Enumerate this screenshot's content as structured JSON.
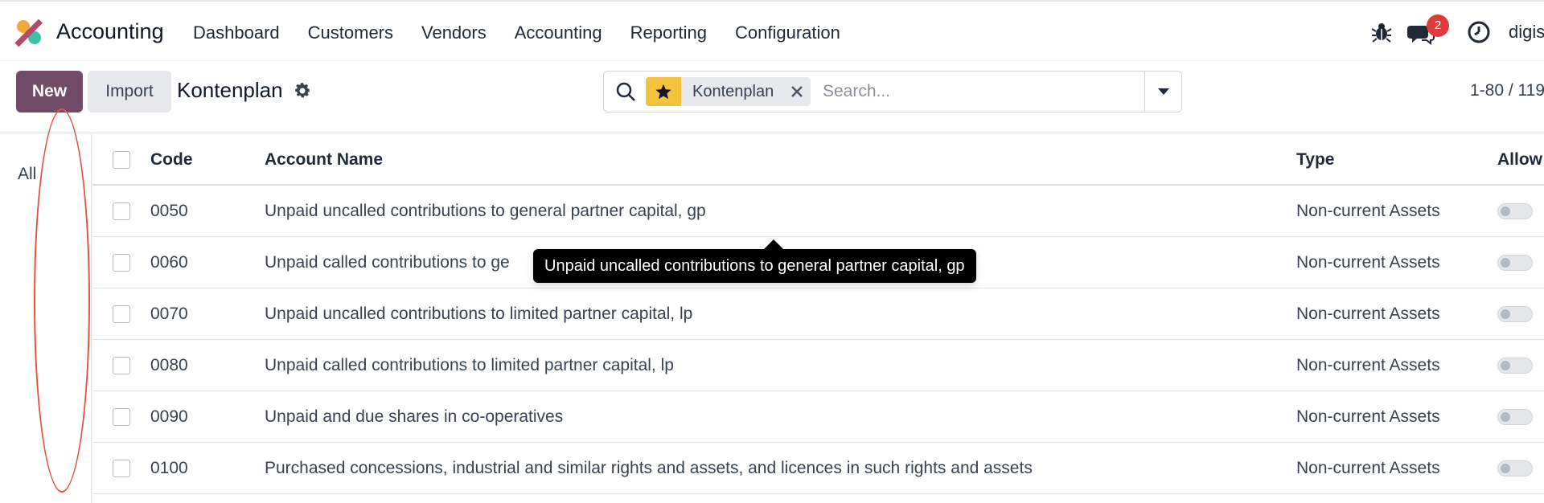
{
  "navbar": {
    "app_name": "Accounting",
    "menu": [
      "Dashboard",
      "Customers",
      "Vendors",
      "Accounting",
      "Reporting",
      "Configuration"
    ],
    "chat_count": "2",
    "company": "digis",
    "icons": [
      "app-logo-icon",
      "bug-icon",
      "chat-icon",
      "clock-icon"
    ]
  },
  "control_panel": {
    "new_label": "New",
    "import_label": "Import",
    "title": "Kontenplan",
    "search": {
      "facet_label": "Kontenplan",
      "placeholder": "Search..."
    },
    "pager": "1-80 / 119"
  },
  "side_panel": {
    "all_label": "All"
  },
  "list": {
    "headers": {
      "code": "Code",
      "name": "Account Name",
      "type": "Type",
      "allow": "Allow"
    },
    "rows": [
      {
        "code": "0050",
        "name": "Unpaid uncalled contributions to general partner capital, gp",
        "type": "Non-current Assets"
      },
      {
        "code": "0060",
        "name": "Unpaid called contributions to ge",
        "type": "Non-current Assets"
      },
      {
        "code": "0070",
        "name": "Unpaid uncalled contributions to limited partner capital, lp",
        "type": "Non-current Assets"
      },
      {
        "code": "0080",
        "name": "Unpaid called contributions to limited partner capital, lp",
        "type": "Non-current Assets"
      },
      {
        "code": "0090",
        "name": "Unpaid and due shares in co-operatives",
        "type": "Non-current Assets"
      },
      {
        "code": "0100",
        "name": "Purchased concessions, industrial and similar rights and assets, and licences in such rights and assets",
        "type": "Non-current Assets"
      }
    ]
  },
  "tooltip": {
    "text": "Unpaid uncalled contributions to general partner capital, gp"
  },
  "colors": {
    "brand": "#714b67",
    "favorite_star": "#f3c33d",
    "badge": "#e03c3c",
    "annotation": "#e8503a"
  }
}
